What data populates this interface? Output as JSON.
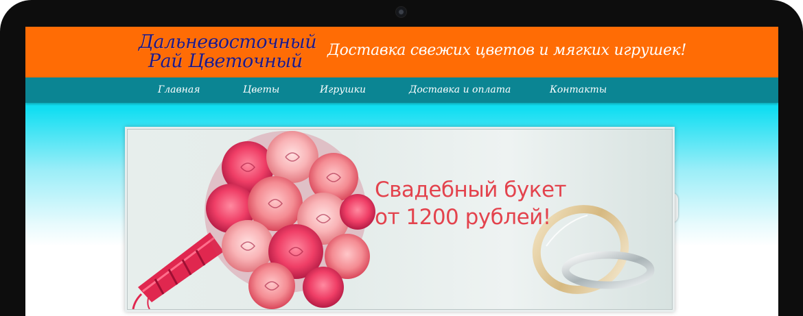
{
  "header": {
    "logo_line1": "Дальневосточный",
    "logo_line2": "Рай Цветочный",
    "tagline": "Доставка свежих цветов и мягких игрушек!"
  },
  "nav": {
    "items": [
      {
        "label": "Главная"
      },
      {
        "label": "Цветы"
      },
      {
        "label": "Игрушки"
      },
      {
        "label": "Доставка и оплата"
      },
      {
        "label": "Контакты"
      }
    ]
  },
  "banner": {
    "line1": "Свадебный букет",
    "line2": "от 1200 рублей!"
  },
  "colors": {
    "header_bg": "#ff6c05",
    "nav_bg": "#0b8593",
    "logo_text": "#1e1a8a",
    "banner_text": "#e3434d",
    "page_bg": "#00e4f6"
  }
}
